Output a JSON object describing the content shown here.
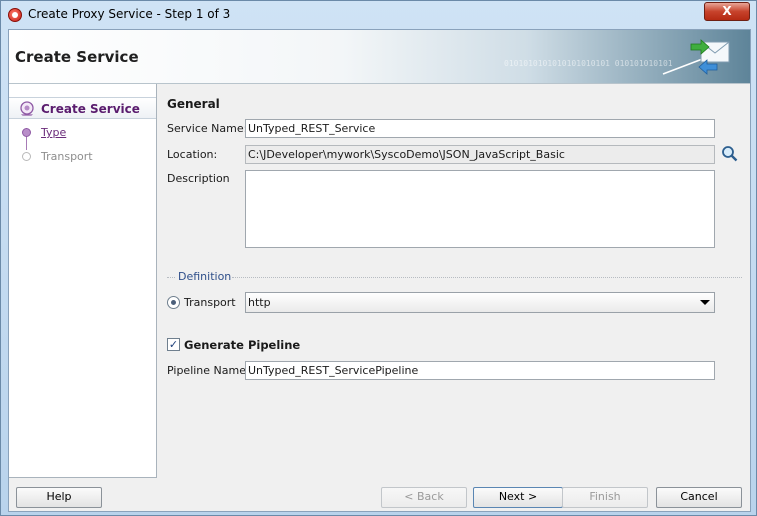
{
  "window": {
    "title": "Create Proxy Service - Step 1 of 3",
    "close_glyph": "X"
  },
  "header": {
    "title": "Create Service",
    "decoration_text": "0101010101010101010101 010101010101",
    "icon": "envelope-exchange-icon"
  },
  "sidebar": {
    "steps": [
      {
        "label": "Create Service",
        "state": "current"
      },
      {
        "label": "Type",
        "state": "link"
      },
      {
        "label": "Transport",
        "state": "disabled"
      }
    ]
  },
  "general": {
    "section_title": "General",
    "service_name_label": "Service Name:",
    "service_name_value": "UnTyped_REST_Service",
    "location_label": "Location:",
    "location_value": "C:\\JDeveloper\\mywork\\SyscoDemo\\JSON_JavaScript_Basic",
    "description_label": "Description",
    "description_value": ""
  },
  "definition": {
    "legend": "Definition",
    "transport_label": "Transport",
    "transport_value": "http",
    "transport_selected": true
  },
  "pipeline": {
    "generate_label": "Generate Pipeline",
    "generate_checked": true,
    "name_label": "Pipeline Name:",
    "name_value": "UnTyped_REST_ServicePipeline"
  },
  "buttons": {
    "help": "Help",
    "back": "< Back",
    "next": "Next >",
    "finish": "Finish",
    "cancel": "Cancel"
  },
  "colors": {
    "accent_purple": "#5a1c6e",
    "definition_blue": "#2f4f8a"
  }
}
